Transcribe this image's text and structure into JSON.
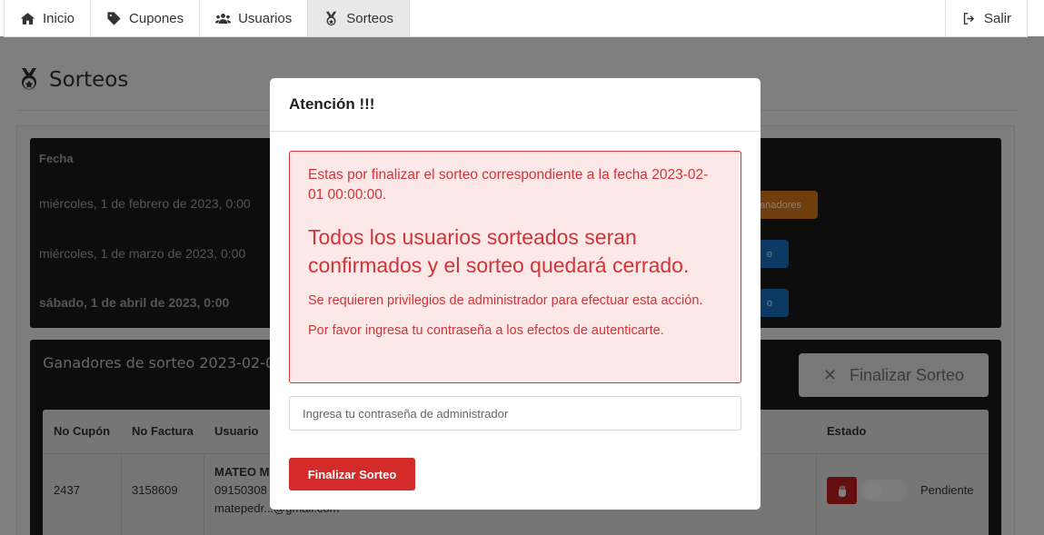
{
  "nav": {
    "items": [
      {
        "label": "Inicio",
        "icon": "home-icon"
      },
      {
        "label": "Cupones",
        "icon": "tag-icon"
      },
      {
        "label": "Usuarios",
        "icon": "users-icon"
      },
      {
        "label": "Sorteos",
        "icon": "medal-icon",
        "active": true
      }
    ],
    "logout_label": "Salir"
  },
  "page": {
    "title": "Sorteos"
  },
  "draws_table": {
    "header_fecha": "Fecha",
    "rows": [
      {
        "fecha": "miércoles, 1 de febrero de 2023, 0:00",
        "action": "Ganadores"
      },
      {
        "fecha": "miércoles, 1 de marzo de 2023, 0:00",
        "action": "o"
      },
      {
        "fecha": "sábado, 1 de abril de 2023, 0:00",
        "action": "o"
      }
    ]
  },
  "winners": {
    "title": "Ganadores de sorteo 2023-02-01 00:00:00",
    "finalize_label": "Finalizar Sorteo",
    "columns": [
      "No Cupón",
      "No Factura",
      "Usuario",
      "Estado"
    ],
    "rows": [
      {
        "cupon": "2437",
        "factura": "3158609",
        "usuario_nombre": "MATEO M",
        "usuario_tel": "09150308",
        "usuario_email": "matepedr...@gmail.com",
        "estado": "Pendiente"
      }
    ]
  },
  "modal": {
    "title": "Atención !!!",
    "alert_line1": "Estas por finalizar el sorteo correspondiente a la fecha 2023-02-01 00:00:00.",
    "alert_big": "Todos los usuarios sorteados seran confirmados y el sorteo quedará cerrado.",
    "alert_small": "Se requieren privilegios de administrador para efectuar esta acción.",
    "alert_small2": "Por favor ingresa tu contraseña a los efectos de autenticarte.",
    "password_placeholder": "Ingresa tu contraseña de administrador",
    "submit_label": "Finalizar Sorteo"
  },
  "colors": {
    "danger": "#d42a2a",
    "alert_bg": "#fde8e8",
    "orange": "#e07b1a",
    "blue": "#1b74c9"
  }
}
